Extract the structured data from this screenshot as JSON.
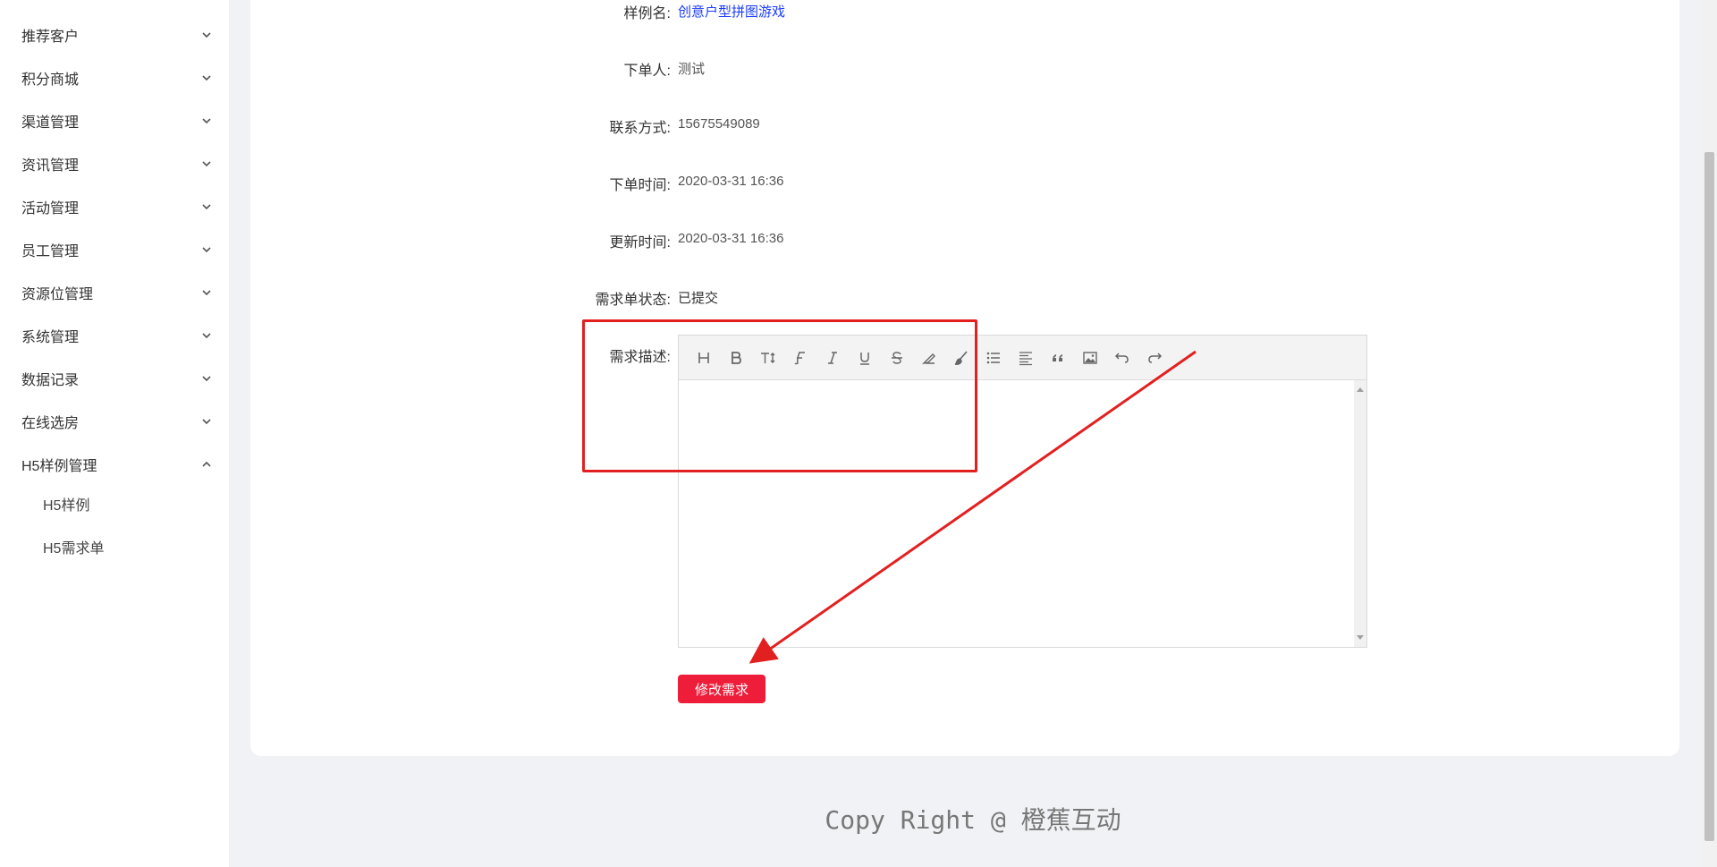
{
  "sidebar": {
    "items": [
      {
        "label": "推荐客户"
      },
      {
        "label": "积分商城"
      },
      {
        "label": "渠道管理"
      },
      {
        "label": "资讯管理"
      },
      {
        "label": "活动管理"
      },
      {
        "label": "员工管理"
      },
      {
        "label": "资源位管理"
      },
      {
        "label": "系统管理"
      },
      {
        "label": "数据记录"
      },
      {
        "label": "在线选房"
      },
      {
        "label": "H5样例管理",
        "expanded": true
      }
    ],
    "sub_items": [
      {
        "label": "H5样例"
      },
      {
        "label": "H5需求单"
      }
    ]
  },
  "detail": {
    "sample_name_label": "样例名:",
    "sample_name_value": "创意户型拼图游戏",
    "orderer_label": "下单人:",
    "orderer_value": "测试",
    "contact_label": "联系方式:",
    "contact_value": "15675549089",
    "order_time_label": "下单时间:",
    "order_time_value": "2020-03-31 16:36",
    "update_time_label": "更新时间:",
    "update_time_value": "2020-03-31 16:36",
    "status_label": "需求单状态:",
    "status_value": "已提交",
    "description_label": "需求描述:"
  },
  "editor": {
    "toolbar_icons": [
      "heading-icon",
      "bold-icon",
      "font-size-icon",
      "font-family-icon",
      "italic-icon",
      "underline-icon",
      "strikethrough-icon",
      "highlight-icon",
      "brush-icon",
      "list-icon",
      "align-icon",
      "quote-icon",
      "image-icon",
      "undo-icon",
      "redo-icon"
    ]
  },
  "actions": {
    "submit_label": "修改需求"
  },
  "footer": {
    "text": "Copy Right @ 橙蕉互动"
  },
  "colors": {
    "accent": "#ee1d3a",
    "link": "#1a3cff",
    "annotation": "#e32020"
  }
}
